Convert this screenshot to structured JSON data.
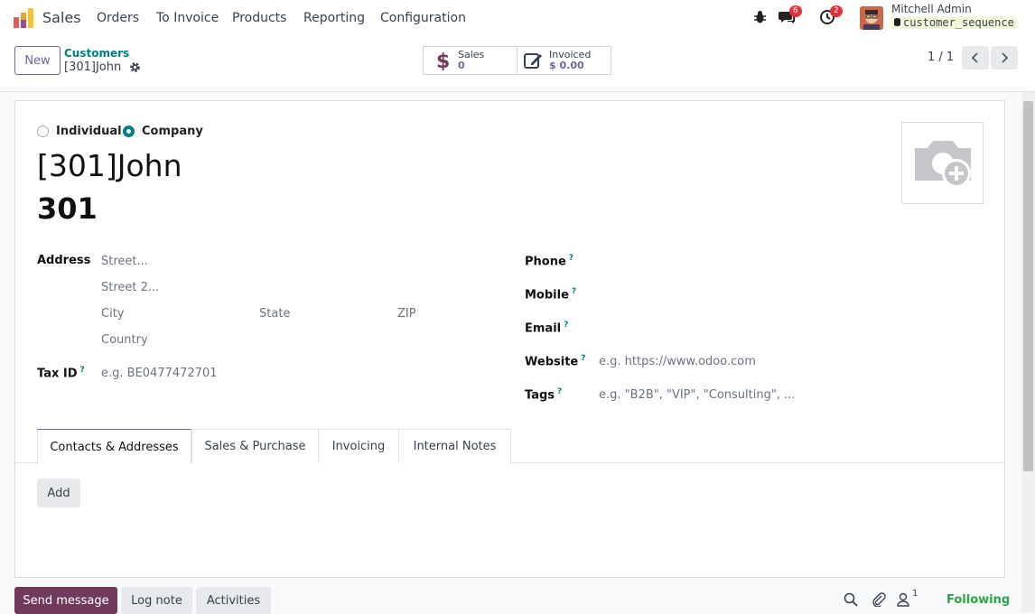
{
  "navbar": {
    "app_name": "Sales",
    "menu": [
      "Orders",
      "To Invoice",
      "Products",
      "Reporting",
      "Configuration"
    ],
    "messages_count": "6",
    "activities_count": "2",
    "user_name": "Mitchell Admin",
    "database": "customer_sequence"
  },
  "control": {
    "new_label": "New",
    "breadcrumb_parent": "Customers",
    "breadcrumb_current": "[301]John",
    "stats": [
      {
        "label": "Sales",
        "value": "0",
        "icon": "dollar-icon"
      },
      {
        "label": "Invoiced",
        "value": "$ 0.00",
        "icon": "invoice-edit-icon"
      }
    ],
    "pager": "1 / 1"
  },
  "form": {
    "company_types": [
      {
        "label": "Individual",
        "selected": false
      },
      {
        "label": "Company",
        "selected": true
      }
    ],
    "name": "[301]John",
    "reference": "301",
    "address_label": "Address",
    "street_placeholder": "Street...",
    "street2_placeholder": "Street 2...",
    "city_placeholder": "City",
    "state_placeholder": "State",
    "zip_placeholder": "ZIP",
    "country_placeholder": "Country",
    "tax_label": "Tax ID",
    "tax_placeholder": "e.g. BE0477472701",
    "phone_label": "Phone",
    "mobile_label": "Mobile",
    "email_label": "Email",
    "website_label": "Website",
    "website_placeholder": "e.g. https://www.odoo.com",
    "tags_label": "Tags",
    "tags_placeholder": "e.g. \"B2B\", \"VIP\", \"Consulting\", ...",
    "help_mark": "?"
  },
  "tabs": [
    "Contacts & Addresses",
    "Sales & Purchase",
    "Invoicing",
    "Internal Notes"
  ],
  "add_label": "Add",
  "chatter": {
    "send_message": "Send message",
    "log_note": "Log note",
    "activities": "Activities",
    "followers_count": "1",
    "following": "Following"
  }
}
